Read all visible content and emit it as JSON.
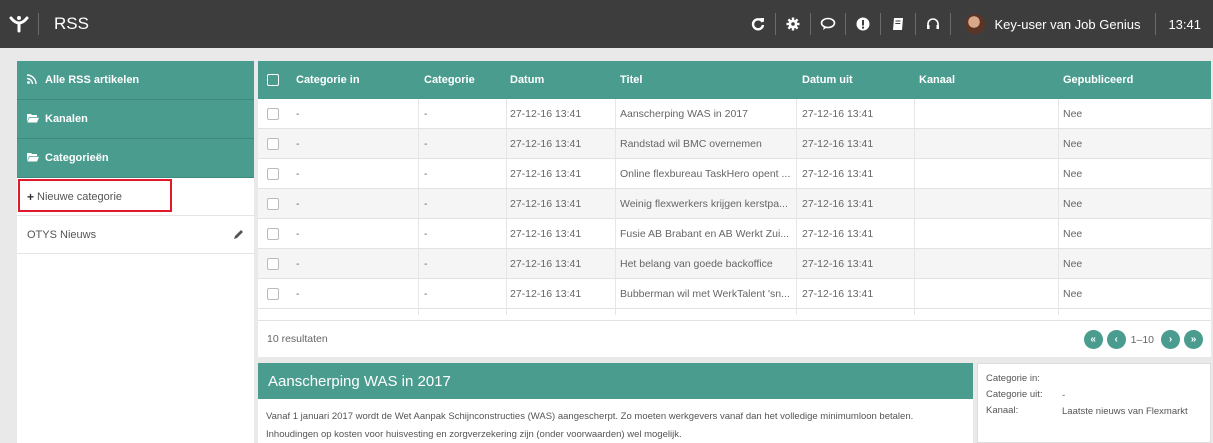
{
  "topbar": {
    "title": "RSS",
    "icons": [
      "refresh-icon",
      "gear-icon",
      "chat-icon",
      "alert-icon",
      "book-icon",
      "headset-icon"
    ],
    "user_name": "Key-user van Job Genius",
    "time": "13:41"
  },
  "sidebar": {
    "all_articles": "Alle RSS artikelen",
    "channels": "Kanalen",
    "categories": "Categorieën",
    "new_category": "Nieuwe categorie",
    "category_item": "OTYS Nieuws"
  },
  "table": {
    "headers": {
      "categorie_in": "Categorie in",
      "categorie": "Categorie",
      "datum": "Datum",
      "titel": "Titel",
      "datum_uit": "Datum uit",
      "kanaal": "Kanaal",
      "gepubliceerd": "Gepubliceerd"
    },
    "rows": [
      {
        "categorie_in": "-",
        "categorie": "-",
        "datum": "27-12-16 13:41",
        "titel": "Aanscherping WAS in 2017",
        "datum_uit": "27-12-16 13:41",
        "kanaal": "",
        "gepubliceerd": "Nee"
      },
      {
        "categorie_in": "-",
        "categorie": "-",
        "datum": "27-12-16 13:41",
        "titel": "Randstad wil BMC overnemen",
        "datum_uit": "27-12-16 13:41",
        "kanaal": "",
        "gepubliceerd": "Nee"
      },
      {
        "categorie_in": "-",
        "categorie": "-",
        "datum": "27-12-16 13:41",
        "titel": "Online flexbureau TaskHero opent ...",
        "datum_uit": "27-12-16 13:41",
        "kanaal": "",
        "gepubliceerd": "Nee"
      },
      {
        "categorie_in": "-",
        "categorie": "-",
        "datum": "27-12-16 13:41",
        "titel": "Weinig flexwerkers krijgen kerstpa...",
        "datum_uit": "27-12-16 13:41",
        "kanaal": "",
        "gepubliceerd": "Nee"
      },
      {
        "categorie_in": "-",
        "categorie": "-",
        "datum": "27-12-16 13:41",
        "titel": "Fusie AB Brabant en AB Werkt Zui...",
        "datum_uit": "27-12-16 13:41",
        "kanaal": "",
        "gepubliceerd": "Nee"
      },
      {
        "categorie_in": "-",
        "categorie": "-",
        "datum": "27-12-16 13:41",
        "titel": "Het belang van goede backoffice",
        "datum_uit": "27-12-16 13:41",
        "kanaal": "",
        "gepubliceerd": "Nee"
      },
      {
        "categorie_in": "-",
        "categorie": "-",
        "datum": "27-12-16 13:41",
        "titel": "Bubberman wil met WerkTalent 'sn...",
        "datum_uit": "27-12-16 13:41",
        "kanaal": "",
        "gepubliceerd": "Nee"
      }
    ],
    "results": "10 resultaten",
    "page_range": "1–10"
  },
  "detail": {
    "title": "Aanscherping WAS in 2017",
    "body": "Vanaf 1 januari 2017 wordt de Wet Aanpak Schijnconstructies (WAS) aangescherpt. Zo moeten werkgevers vanaf dan het volledige minimumloon betalen. Inhoudingen op kosten voor huisvesting en zorgverzekering zijn (onder voorwaarden) wel mogelijk."
  },
  "meta": {
    "categorie_in_label": "Categorie in:",
    "categorie_in_value": "",
    "categorie_uit_label": "Categorie uit:",
    "categorie_uit_value": "-",
    "kanaal_label": "Kanaal:",
    "kanaal_value": "Laatste nieuws van Flexmarkt"
  },
  "colors": {
    "accent": "#4a9c8f",
    "topbar": "#3d3d3d",
    "highlight": "#e0192b"
  }
}
